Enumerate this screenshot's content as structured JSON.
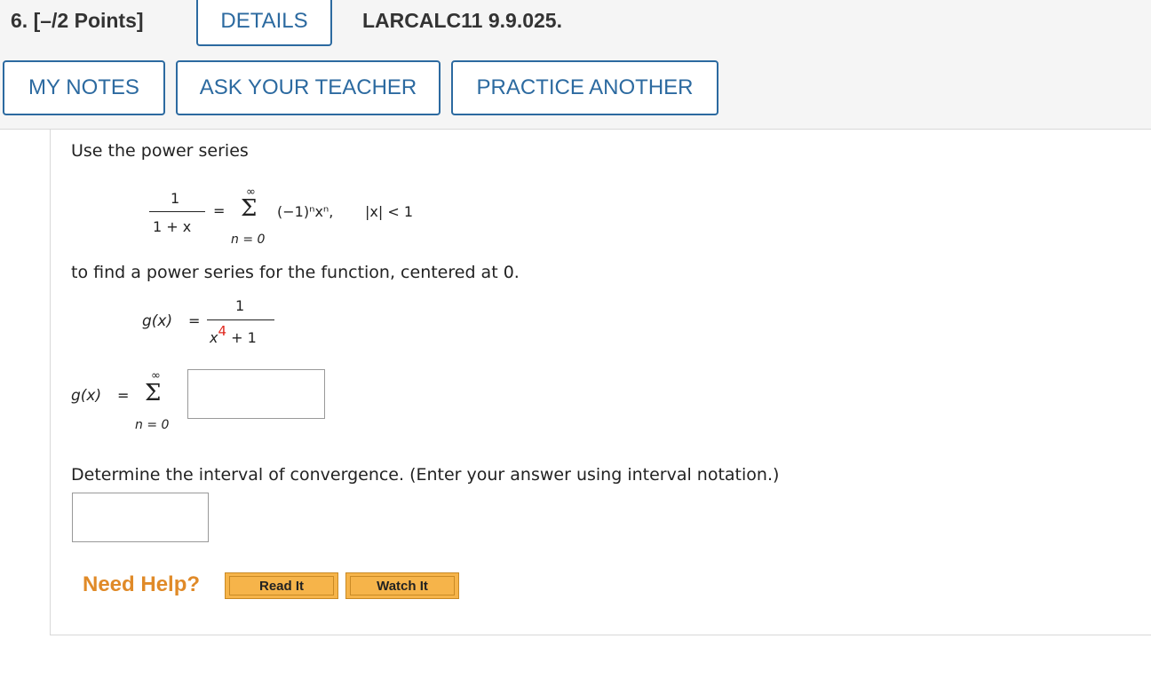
{
  "header": {
    "question_number": "6.",
    "points": "[–/2 Points]",
    "details_label": "DETAILS",
    "problem_code": "LARCALC11 9.9.025.",
    "my_notes_label": "MY NOTES",
    "ask_teacher_label": "ASK YOUR TEACHER",
    "practice_another_label": "PRACTICE ANOTHER"
  },
  "problem": {
    "intro": "Use the power series",
    "series": {
      "lhs_numerator": "1",
      "lhs_denominator": "1 + x",
      "equals": "=",
      "sum_upper": "∞",
      "sum_symbol": "Σ",
      "sum_lower": "n = 0",
      "term": "(−1)ⁿxⁿ,",
      "condition": "|x| < 1"
    },
    "instruction": "to find a power series for the function, centered at 0.",
    "function": {
      "name": "g(x)",
      "equals": "=",
      "numerator": "1",
      "denominator_base": "x",
      "denominator_exp": "4",
      "denominator_rest": "+ 1"
    },
    "answer_series": {
      "name": "g(x)",
      "equals": "=",
      "sum_upper": "∞",
      "sum_symbol": "Σ",
      "sum_lower": "n = 0",
      "input_value": ""
    },
    "interval_prompt": "Determine the interval of convergence. (Enter your answer using interval notation.)",
    "interval_input_value": ""
  },
  "help": {
    "label": "Need Help?",
    "read_it": "Read It",
    "watch_it": "Watch It"
  }
}
